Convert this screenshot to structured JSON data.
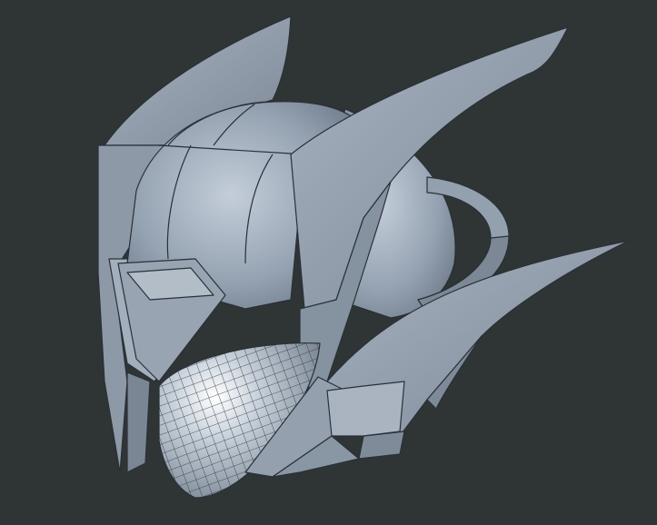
{
  "viewport": {
    "background_color": "#2f3535",
    "shading_mode": "shaded-with-edges"
  },
  "model": {
    "object": "helmet-mesh",
    "base_color": "#8e9aa8",
    "shadow_color": "#5f6b78",
    "highlight_color": "#c8d2dc",
    "edge_color": "#2a3038"
  }
}
